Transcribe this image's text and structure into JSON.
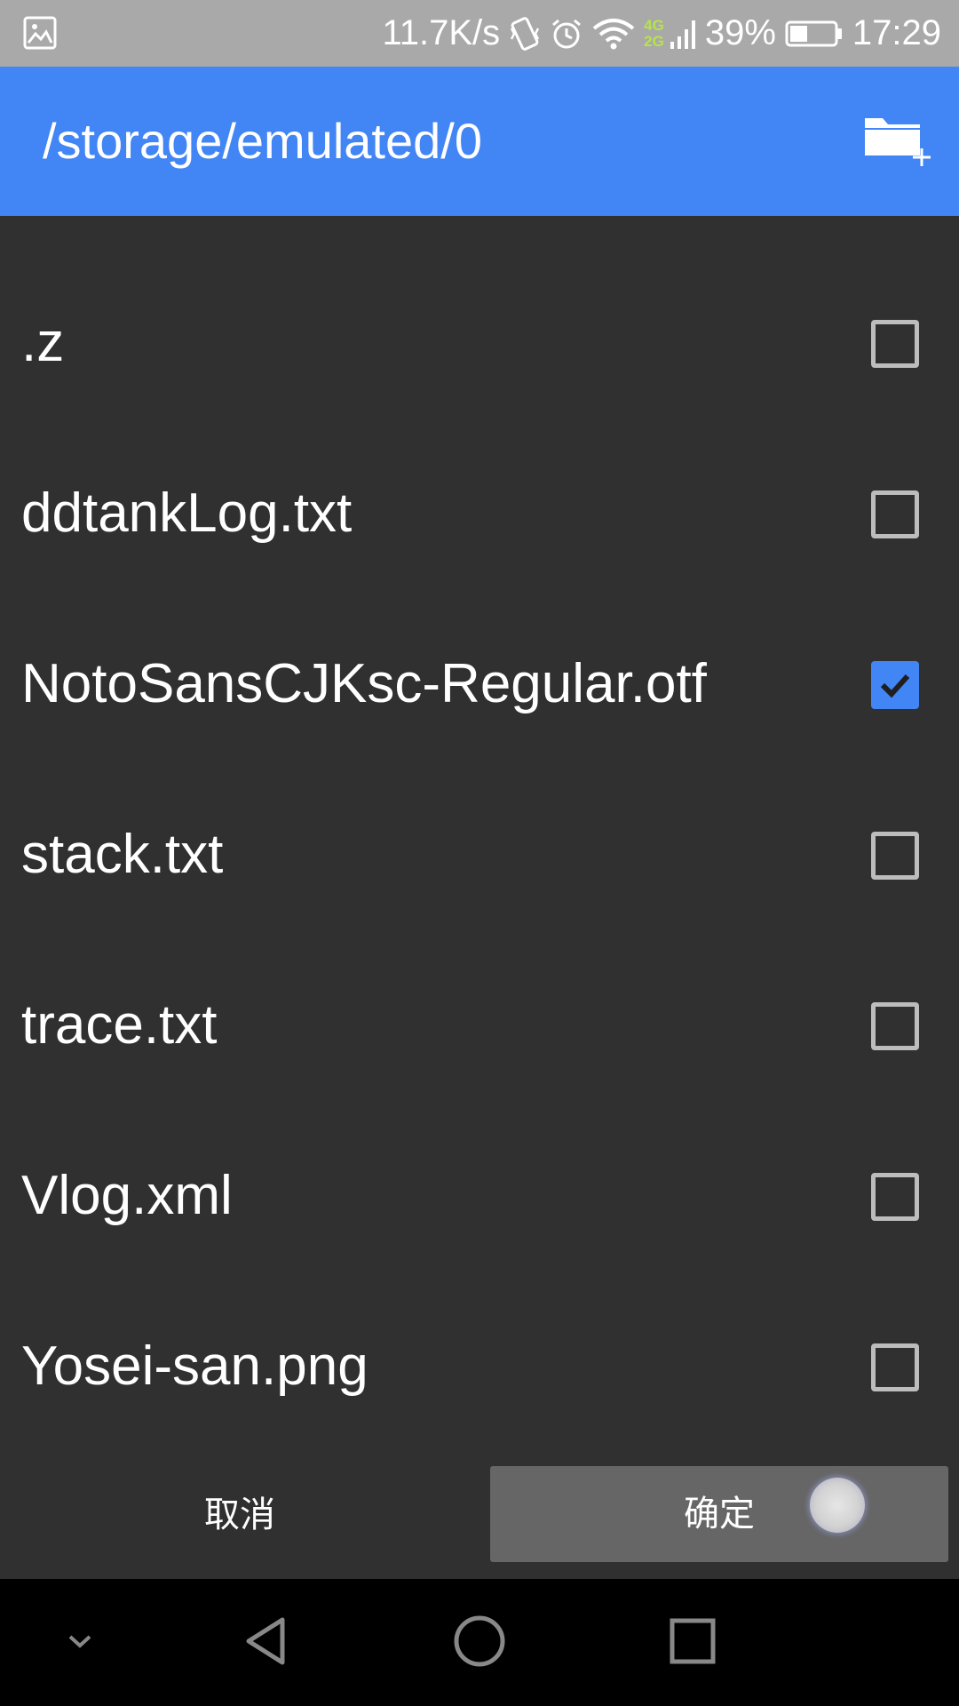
{
  "status_bar": {
    "net_speed": "11.7K/s",
    "net_type_top": "4G",
    "net_type_bottom": "2G",
    "battery_percent": "39%",
    "battery_level": 0.39,
    "time": "17:29",
    "icons": [
      "image-notification-icon",
      "vibrate-icon",
      "alarm-icon",
      "wifi-icon",
      "cell-signal-icon",
      "battery-icon"
    ]
  },
  "toolbar": {
    "title": "/storage/emulated/0",
    "new_folder_icon": "new-folder-icon"
  },
  "files": [
    {
      "name": ".z",
      "checked": false
    },
    {
      "name": "ddtankLog.txt",
      "checked": false
    },
    {
      "name": "NotoSansCJKsc-Regular.otf",
      "checked": true
    },
    {
      "name": "stack.txt",
      "checked": false
    },
    {
      "name": "trace.txt",
      "checked": false
    },
    {
      "name": "Vlog.xml",
      "checked": false
    },
    {
      "name": "Yosei-san.png",
      "checked": false
    }
  ],
  "dialog_buttons": {
    "cancel_label": "取消",
    "ok_label": "确定"
  },
  "nav_bar": {
    "icons": [
      "collapse-chevron-icon",
      "back-icon",
      "home-icon",
      "recents-icon"
    ]
  },
  "colors": {
    "accent": "#4285f4",
    "background": "#303030",
    "status_bar": "#a9a9a9",
    "ok_button": "#666666"
  }
}
